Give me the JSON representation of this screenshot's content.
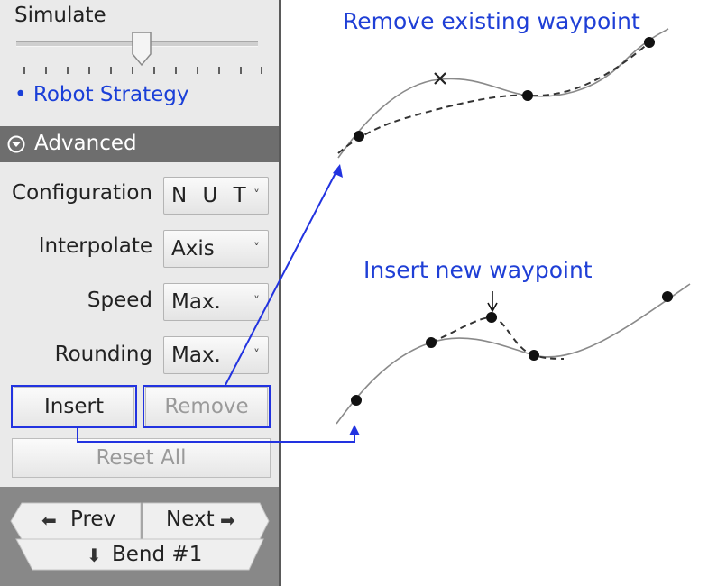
{
  "panel": {
    "simulate_label": "Simulate",
    "robot_strategy_label": "• Robot Strategy",
    "advanced_label": "Advanced",
    "rows": {
      "configuration": {
        "label": "Configuration",
        "value": "N U T"
      },
      "interpolate": {
        "label": "Interpolate",
        "value": "Axis"
      },
      "speed": {
        "label": "Speed",
        "value": "Max."
      },
      "rounding": {
        "label": "Rounding",
        "value": "Max."
      }
    },
    "buttons": {
      "insert": "Insert",
      "remove": "Remove",
      "reset_all": "Reset All",
      "prev": "Prev",
      "next": "Next",
      "bend": "Bend #1"
    }
  },
  "annotations": {
    "remove_caption": "Remove existing waypoint",
    "insert_caption": "Insert new waypoint"
  },
  "colors": {
    "accent_blue": "#2233e0",
    "panel_bg": "#eaeaea",
    "header_bg": "#6e6e6e"
  }
}
